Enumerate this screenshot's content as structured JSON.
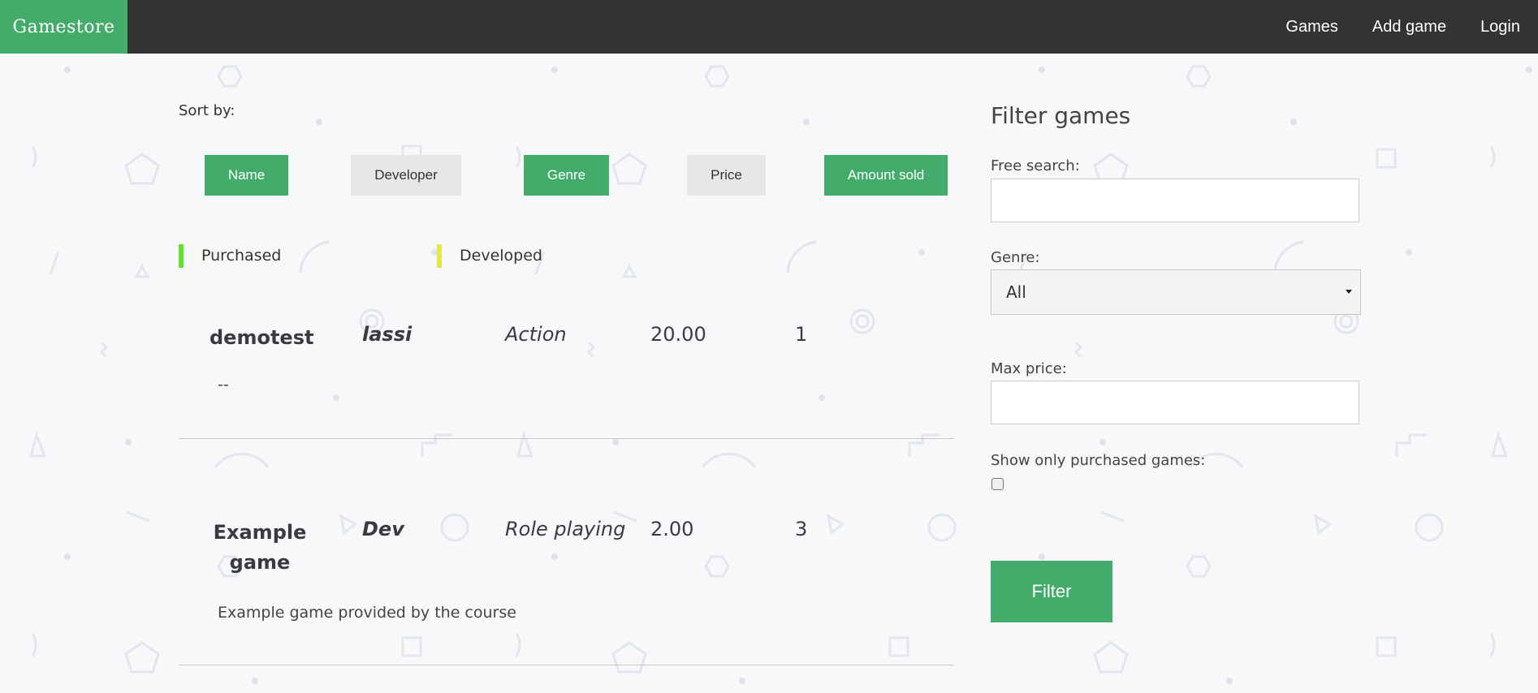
{
  "brand": "Gamestore",
  "nav": {
    "games": "Games",
    "add_game": "Add game",
    "login": "Login"
  },
  "sort": {
    "label": "Sort by:",
    "buttons": [
      {
        "label": "Name",
        "active": true
      },
      {
        "label": "Developer",
        "active": false
      },
      {
        "label": "Genre",
        "active": true
      },
      {
        "label": "Price",
        "active": false
      },
      {
        "label": "Amount sold",
        "active": true
      }
    ]
  },
  "legend": [
    {
      "label": "Purchased",
      "color": "#66e030"
    },
    {
      "label": "Developed",
      "color": "#e3e84a"
    }
  ],
  "games": [
    {
      "name": "demotest",
      "developer": "lassi",
      "genre": "Action",
      "price": "20.00",
      "sold": "1",
      "description": "--"
    },
    {
      "name": "Example game",
      "developer": "Dev",
      "genre": "Role playing",
      "price": "2.00",
      "sold": "3",
      "description": "Example game provided by the course"
    }
  ],
  "filter": {
    "title": "Filter games",
    "free_search_label": "Free search:",
    "free_search_value": "",
    "genre_label": "Genre:",
    "genre_selected": "All",
    "max_price_label": "Max price:",
    "max_price_value": "",
    "purchased_only_label": "Show only purchased games:",
    "purchased_only_checked": false,
    "button": "Filter"
  },
  "colors": {
    "accent": "#43ac6a",
    "navbar": "#333333",
    "background": "#f7f8fa"
  }
}
